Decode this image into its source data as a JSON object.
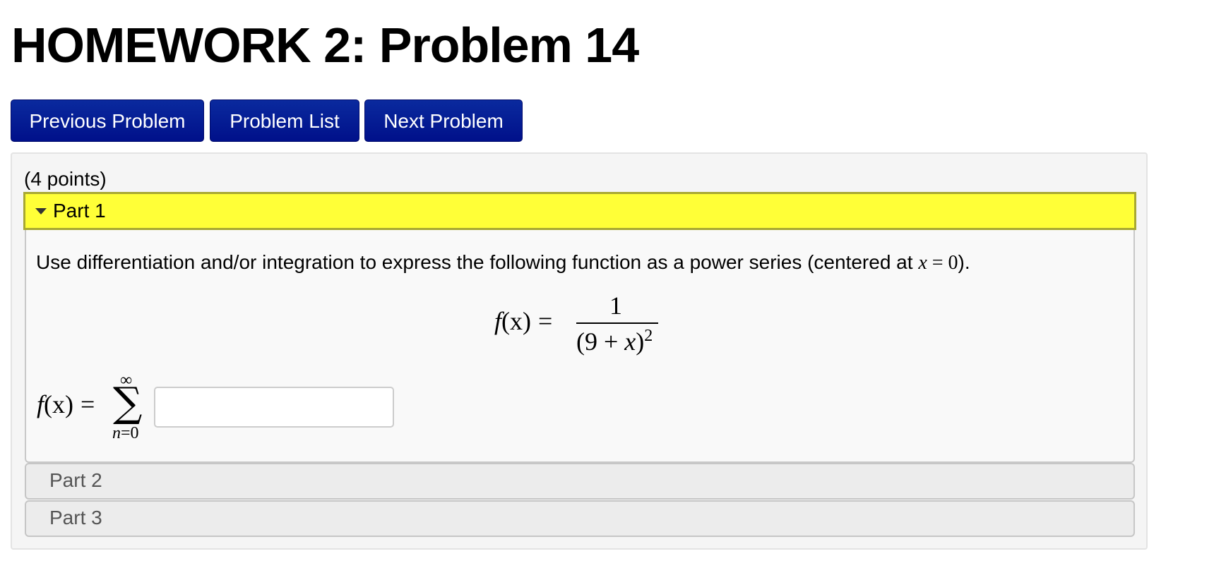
{
  "page": {
    "title": "HOMEWORK 2: Problem 14"
  },
  "nav": {
    "previous_label": "Previous Problem",
    "list_label": "Problem List",
    "next_label": "Next Problem",
    "button_color": "#00128f"
  },
  "problem": {
    "points": "(4 points)",
    "parts": [
      {
        "label": "Part 1",
        "expanded": true,
        "header_color": "#ffff37",
        "question": {
          "text_before": "Use differentiation and/or integration to express the following function as a power series (centered at ",
          "var": "x",
          "eq": " = 0",
          "text_after": ")."
        },
        "display_equation": {
          "lhs_f": "f",
          "lhs_args": "(x)",
          "equals": "=",
          "numerator": "1",
          "denominator_open": "(9 + ",
          "denominator_var": "x",
          "denominator_close": ")",
          "exponent": "2"
        },
        "answer": {
          "lhs_f": "f",
          "lhs_args": "(x)",
          "equals": "=",
          "sum_upper": "∞",
          "sum_symbol": "∑",
          "sum_lower_var": "n",
          "sum_lower_rest": "=0",
          "input_value": "",
          "input_placeholder": ""
        }
      },
      {
        "label": "Part 2",
        "expanded": false
      },
      {
        "label": "Part 3",
        "expanded": false
      }
    ]
  }
}
